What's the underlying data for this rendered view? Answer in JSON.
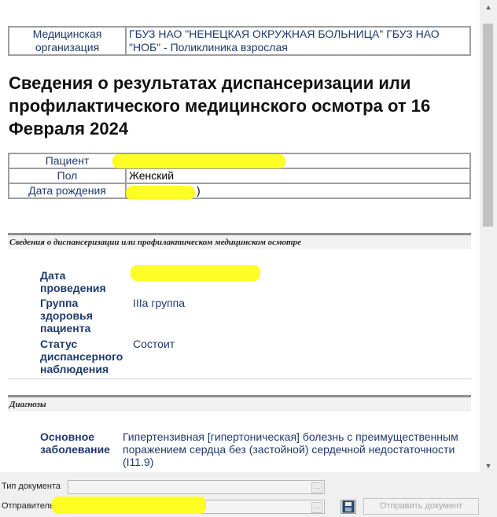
{
  "organization": {
    "label": "Медицинская организация",
    "value": "ГБУЗ НАО \"НЕНЕЦКАЯ ОКРУЖНАЯ БОЛЬНИЦА\" ГБУЗ НАО \"НОБ\" - Поликлиника взрослая"
  },
  "title": "Сведения о результатах диспансеризации или профилактического медицинского осмотра от 16 Февраля 2024",
  "patient": {
    "patient_label": "Пациент",
    "patient_value": "",
    "sex_label": "Пол",
    "sex_value": "Женский",
    "birth_label": "Дата рождения",
    "birth_value": ")"
  },
  "exam_section": {
    "header": "Сведения о диспансеризации или профилактическом медицинском осмотре",
    "date_label": "Дата проведения",
    "date_value": "",
    "group_label": "Группа здоровья пациента",
    "group_value": "IIIa группа",
    "status_label": "Статус диспансерного наблюдения",
    "status_value": "Состоит"
  },
  "diagnoses_section": {
    "header": "Диагнозы",
    "main_label": "Основное заболевание",
    "main_value": "Гипертензивная [гипертоническая] болезнь с преимущественным поражением сердца без (застойной) сердечной недостаточности (I11.9)"
  },
  "bottom": {
    "doc_type_label": "Тип документа",
    "doc_type_value": "",
    "sender_label": "Отправитель",
    "sender_value": "",
    "send_button": "Отправить документ"
  },
  "colors": {
    "text_blue": "#1f3a6b",
    "highlight": "#ffff1a"
  }
}
